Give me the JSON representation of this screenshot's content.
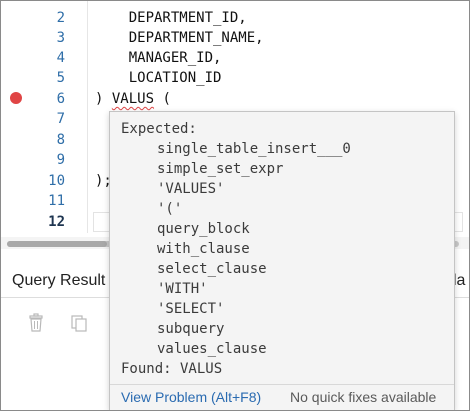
{
  "editor": {
    "lines": [
      {
        "num": "2",
        "text": "    DEPARTMENT_ID,",
        "breakpoint": false,
        "current": false
      },
      {
        "num": "3",
        "text": "    DEPARTMENT_NAME,",
        "breakpoint": false,
        "current": false
      },
      {
        "num": "4",
        "text": "    MANAGER_ID,",
        "breakpoint": false,
        "current": false
      },
      {
        "num": "5",
        "text": "    LOCATION_ID",
        "breakpoint": false,
        "current": false
      },
      {
        "num": "6",
        "text_before": ") ",
        "squiggle": "VALUS",
        "text_after": " (",
        "breakpoint": true,
        "current": false
      },
      {
        "num": "7",
        "text": "",
        "breakpoint": false,
        "current": false
      },
      {
        "num": "8",
        "text": "",
        "breakpoint": false,
        "current": false
      },
      {
        "num": "9",
        "text": "",
        "breakpoint": false,
        "current": false
      },
      {
        "num": "10",
        "text": ");",
        "breakpoint": false,
        "current": false
      },
      {
        "num": "11",
        "text": "",
        "breakpoint": false,
        "current": false
      },
      {
        "num": "12",
        "text": "",
        "breakpoint": false,
        "current": true
      }
    ]
  },
  "panel": {
    "tab_label": "Query Result",
    "tab_right_partial": "la",
    "icons": [
      "trash-icon",
      "copy-icon"
    ]
  },
  "popup": {
    "expected_label": "Expected:",
    "expected_items": [
      "single_table_insert___0",
      "simple_set_expr",
      "'VALUES'",
      "'('",
      "query_block",
      "with_clause",
      "select_clause",
      "'WITH'",
      "'SELECT'",
      "subquery",
      "values_clause"
    ],
    "found_label": "Found: VALUS",
    "view_problem": "View Problem (Alt+F8)",
    "no_fixes": "No quick fixes available"
  },
  "colors": {
    "breakpoint": "#e04545",
    "line_number": "#2f6ea8",
    "link": "#2a6bb1",
    "popup_bg": "#f4f4f4"
  }
}
